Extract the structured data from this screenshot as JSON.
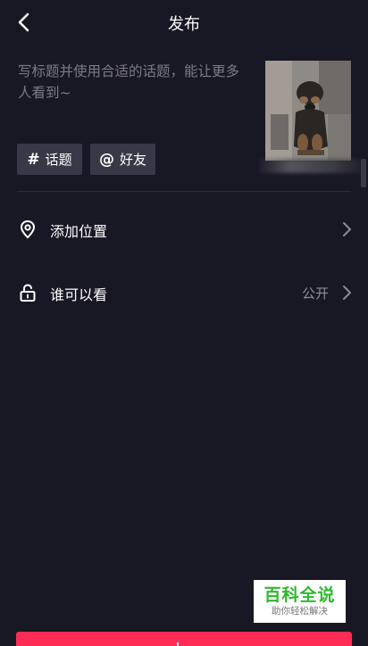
{
  "header": {
    "title": "发布",
    "back_icon": "chevron-left-icon"
  },
  "caption": {
    "placeholder": "写标题并使用合适的话题，能让更多人看到~"
  },
  "chips": {
    "topic": {
      "symbol": "#",
      "label": "话题"
    },
    "friend": {
      "symbol": "@",
      "label": "好友"
    }
  },
  "rows": {
    "location": {
      "label": "添加位置",
      "icon": "location-pin-icon"
    },
    "visibility": {
      "label": "谁可以看",
      "value": "公开",
      "icon": "unlock-icon"
    }
  },
  "watermark": {
    "main": "百科全说",
    "sub": "助你轻松解决"
  },
  "colors": {
    "background": "#181724",
    "chip": "#393846",
    "publish": "#fe2c55",
    "watermark_green": "#2eb82e"
  }
}
